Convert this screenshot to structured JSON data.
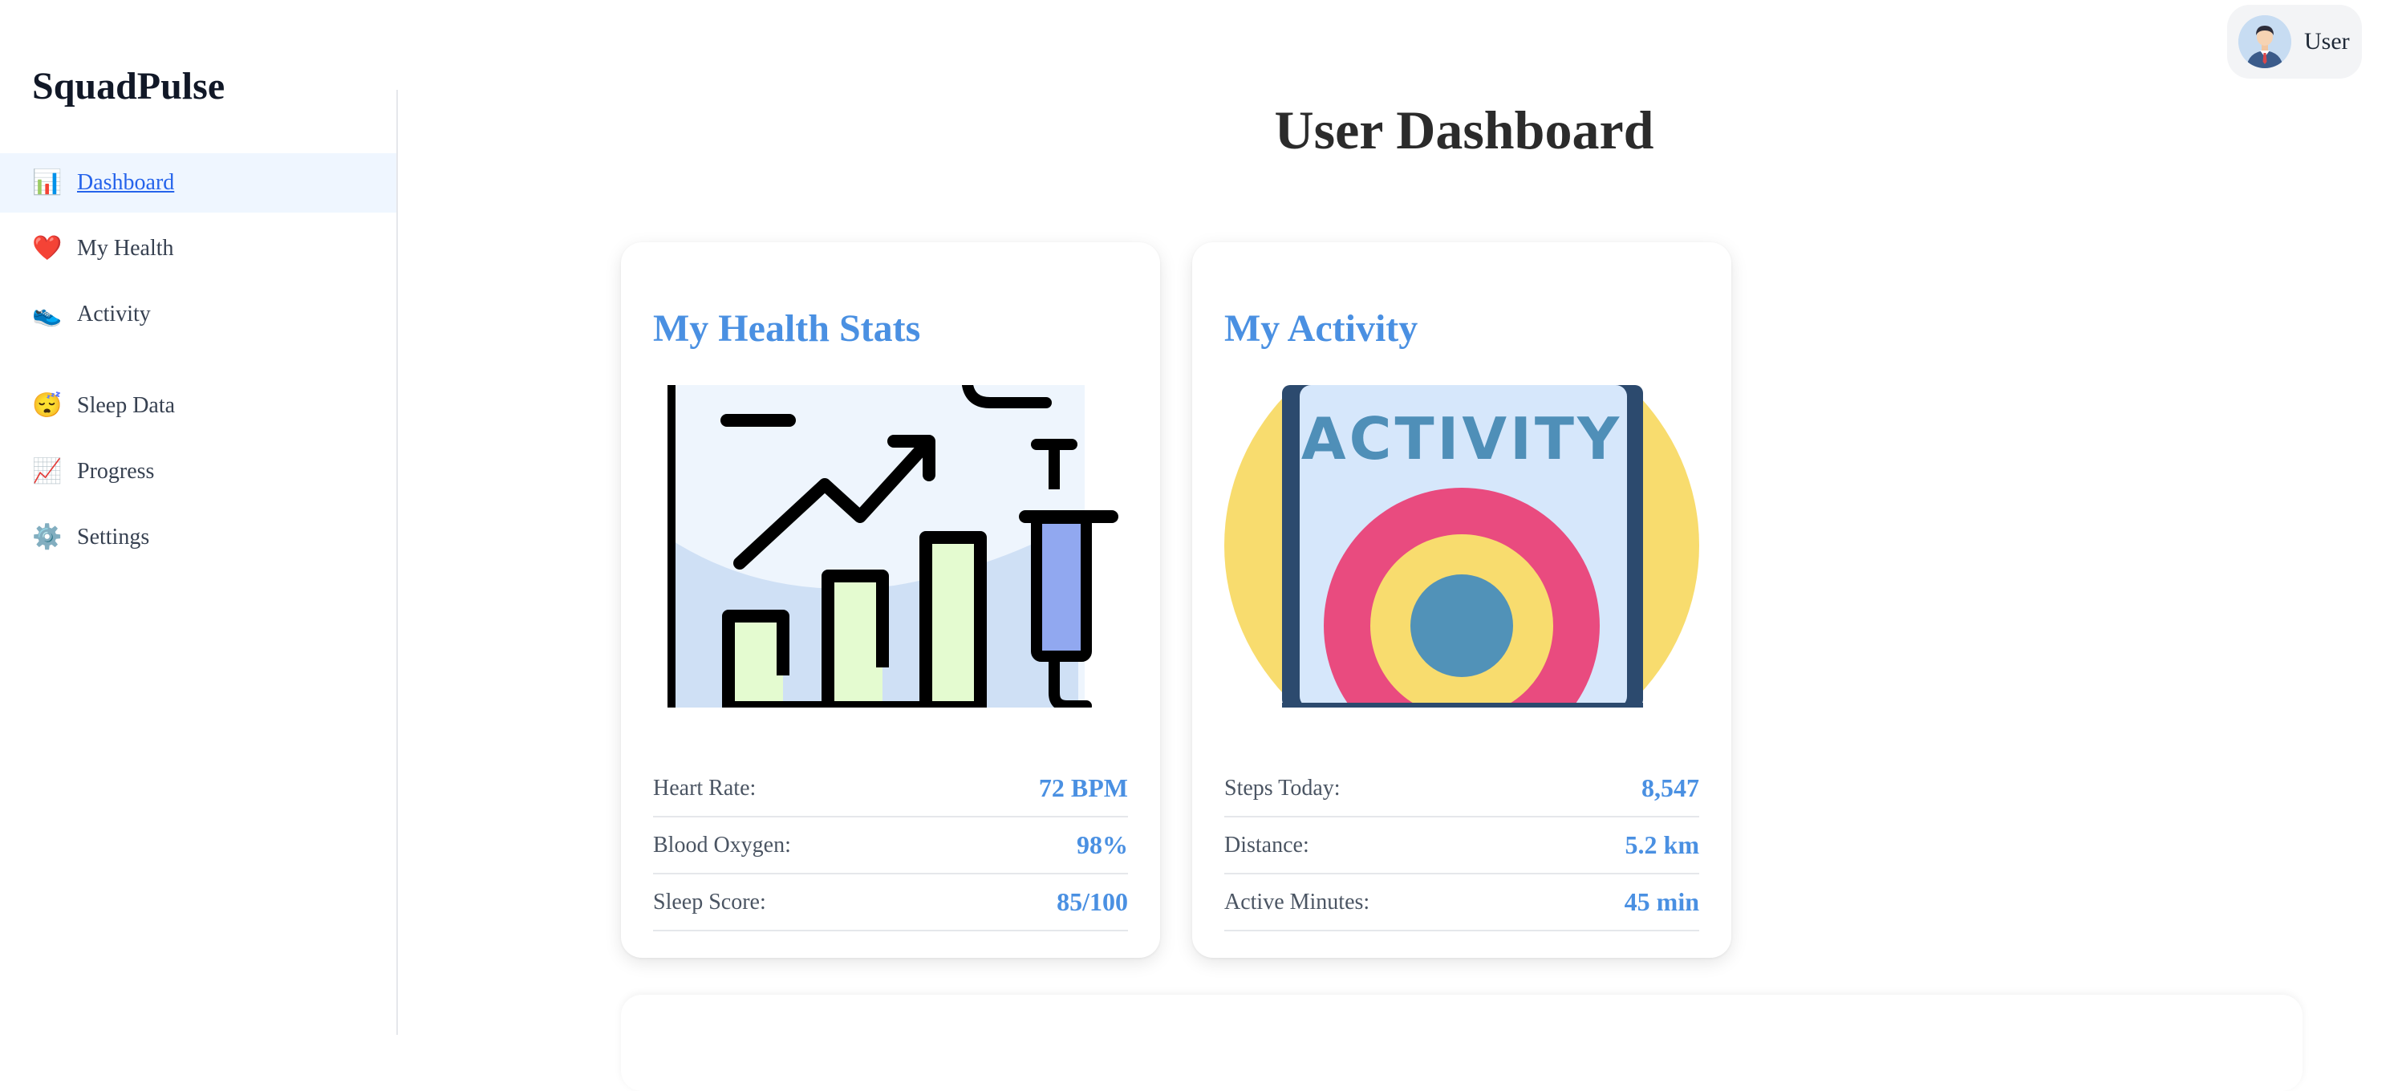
{
  "app": {
    "brand": "SquadPulse"
  },
  "sidebar": {
    "items": [
      {
        "icon": "📊",
        "label": "Dashboard",
        "active": true
      },
      {
        "icon": "❤️",
        "label": "My Health"
      },
      {
        "icon": "👟",
        "label": "Activity"
      },
      {
        "icon": "😴",
        "label": "Sleep Data"
      },
      {
        "icon": "📈",
        "label": "Progress"
      },
      {
        "icon": "⚙️",
        "label": "Settings"
      }
    ]
  },
  "header": {
    "user_label": "User",
    "title": "User Dashboard"
  },
  "cards": {
    "health": {
      "title": "My Health Stats",
      "stats": [
        {
          "label": "Heart Rate:",
          "value": "72 BPM"
        },
        {
          "label": "Blood Oxygen:",
          "value": "98%"
        },
        {
          "label": "Sleep Score:",
          "value": "85/100"
        }
      ]
    },
    "activity": {
      "title": "My Activity",
      "image_text": "ACTIVITY",
      "stats": [
        {
          "label": "Steps Today:",
          "value": "8,547"
        },
        {
          "label": "Distance:",
          "value": "5.2 km"
        },
        {
          "label": "Active Minutes:",
          "value": "45 min"
        }
      ]
    }
  },
  "colors": {
    "accent": "#4a90e2",
    "active_nav_bg": "#eff6ff",
    "active_nav_text": "#2563eb"
  }
}
